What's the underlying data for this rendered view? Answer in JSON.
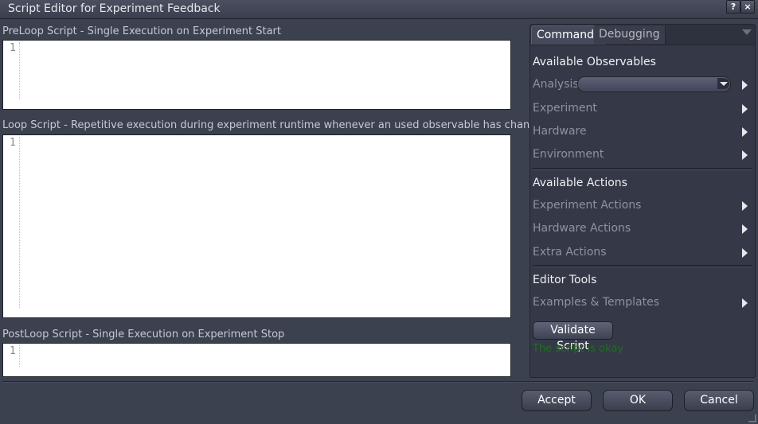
{
  "window": {
    "title": "Script Editor for Experiment Feedback",
    "help_label": "?",
    "close_label": "×"
  },
  "editors": {
    "preloop": {
      "label": "PreLoop Script - Single Execution on Experiment Start",
      "line_number": "1"
    },
    "loop": {
      "label": "Loop Script - Repetitive execution during experiment runtime whenever an used observable has changed",
      "line_number": "1"
    },
    "postloop": {
      "label": "PostLoop Script - Single Execution on Experiment Stop",
      "line_number": "1"
    }
  },
  "panel": {
    "tabs": [
      {
        "label": "Commands",
        "active": true
      },
      {
        "label": "Debugging",
        "active": false
      }
    ],
    "observables": {
      "heading": "Available Observables",
      "items": [
        {
          "label": "Analysis",
          "has_dropdown": true,
          "dropdown_value": ""
        },
        {
          "label": "Experiment"
        },
        {
          "label": "Hardware"
        },
        {
          "label": "Environment"
        }
      ]
    },
    "actions": {
      "heading": "Available Actions",
      "items": [
        {
          "label": "Experiment Actions"
        },
        {
          "label": "Hardware Actions"
        },
        {
          "label": "Extra Actions"
        }
      ]
    },
    "tools": {
      "heading": "Editor Tools",
      "items": [
        {
          "label": "Examples & Templates"
        }
      ],
      "validate_label": "Validate Script",
      "status_text": "The script is okay",
      "status_color": "#1f6d1f"
    }
  },
  "footer": {
    "accept_label": "Accept",
    "ok_label": "OK",
    "cancel_label": "Cancel"
  }
}
